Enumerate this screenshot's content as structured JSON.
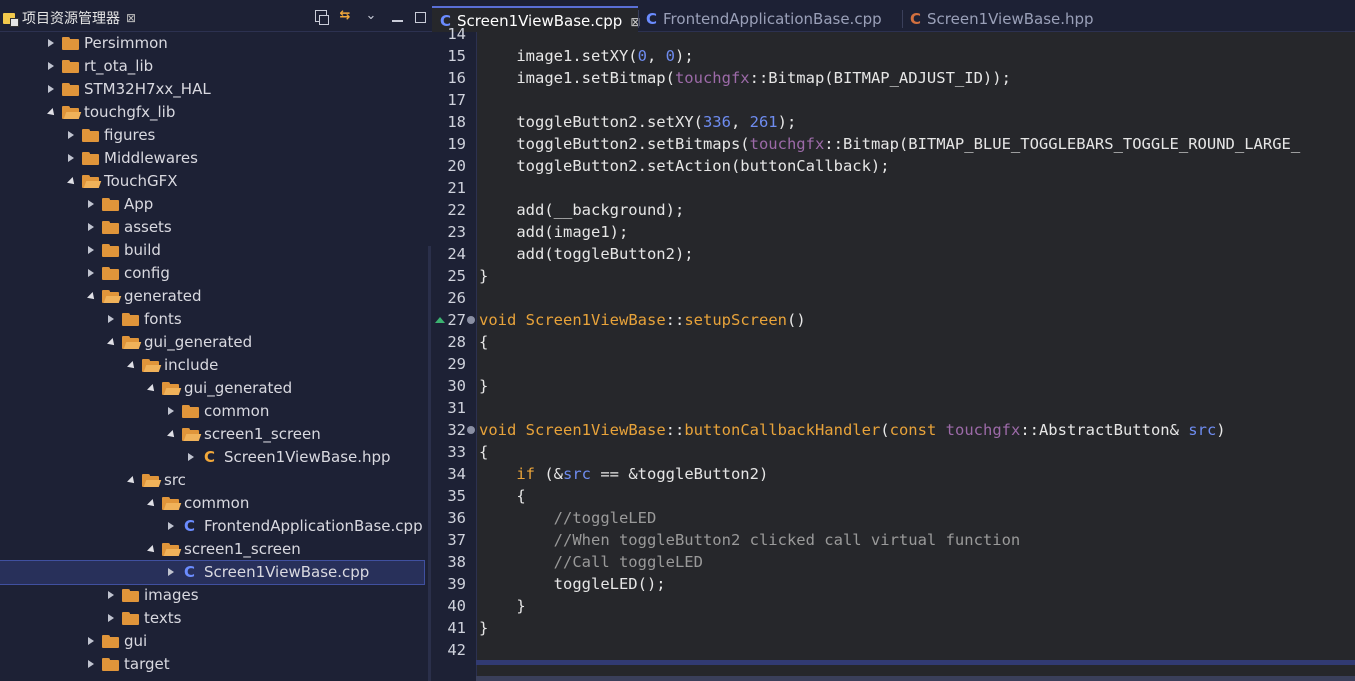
{
  "explorer": {
    "title": "项目资源管理器",
    "close_glyph": "⊠",
    "tree": [
      {
        "label": "Persimmon",
        "depth": 0,
        "kind": "folder",
        "expanded": false
      },
      {
        "label": "rt_ota_lib",
        "depth": 0,
        "kind": "folder",
        "expanded": false
      },
      {
        "label": "STM32H7xx_HAL",
        "depth": 0,
        "kind": "folder",
        "expanded": false
      },
      {
        "label": "touchgfx_lib",
        "depth": 0,
        "kind": "folder",
        "expanded": true
      },
      {
        "label": "figures",
        "depth": 1,
        "kind": "folder",
        "expanded": false
      },
      {
        "label": "Middlewares",
        "depth": 1,
        "kind": "folder",
        "expanded": false
      },
      {
        "label": "TouchGFX",
        "depth": 1,
        "kind": "folder",
        "expanded": true
      },
      {
        "label": "App",
        "depth": 2,
        "kind": "folder",
        "expanded": false
      },
      {
        "label": "assets",
        "depth": 2,
        "kind": "folder",
        "expanded": false
      },
      {
        "label": "build",
        "depth": 2,
        "kind": "folder",
        "expanded": false
      },
      {
        "label": "config",
        "depth": 2,
        "kind": "folder",
        "expanded": false
      },
      {
        "label": "generated",
        "depth": 2,
        "kind": "folder",
        "expanded": true
      },
      {
        "label": "fonts",
        "depth": 3,
        "kind": "folder",
        "expanded": false
      },
      {
        "label": "gui_generated",
        "depth": 3,
        "kind": "folder",
        "expanded": true
      },
      {
        "label": "include",
        "depth": 4,
        "kind": "folder",
        "expanded": true
      },
      {
        "label": "gui_generated",
        "depth": 5,
        "kind": "folder",
        "expanded": true
      },
      {
        "label": "common",
        "depth": 6,
        "kind": "folder",
        "expanded": false
      },
      {
        "label": "screen1_screen",
        "depth": 6,
        "kind": "folder",
        "expanded": true
      },
      {
        "label": "Screen1ViewBase.hpp",
        "depth": 7,
        "kind": "hpp",
        "expanded": false
      },
      {
        "label": "src",
        "depth": 4,
        "kind": "folder",
        "expanded": true
      },
      {
        "label": "common",
        "depth": 5,
        "kind": "folder",
        "expanded": true
      },
      {
        "label": "FrontendApplicationBase.cpp",
        "depth": 6,
        "kind": "cpp",
        "expanded": false
      },
      {
        "label": "screen1_screen",
        "depth": 5,
        "kind": "folder",
        "expanded": true
      },
      {
        "label": "Screen1ViewBase.cpp",
        "depth": 6,
        "kind": "cpp",
        "expanded": false,
        "selected": true
      },
      {
        "label": "images",
        "depth": 3,
        "kind": "folder",
        "expanded": false
      },
      {
        "label": "texts",
        "depth": 3,
        "kind": "folder",
        "expanded": false
      },
      {
        "label": "gui",
        "depth": 2,
        "kind": "folder",
        "expanded": false
      },
      {
        "label": "target",
        "depth": 2,
        "kind": "folder",
        "expanded": false
      }
    ]
  },
  "editor": {
    "tabs": [
      {
        "label": "Screen1ViewBase.cpp",
        "icon": "C",
        "kind": "cpp",
        "active": true,
        "close": "⊠"
      },
      {
        "label": "FrontendApplicationBase.cpp",
        "icon": "C",
        "kind": "cpp",
        "active": false
      },
      {
        "label": "Screen1ViewBase.hpp",
        "icon": "C",
        "kind": "hpp",
        "active": false
      }
    ],
    "lines": [
      {
        "n": "14",
        "segs": []
      },
      {
        "n": "15",
        "segs": [
          [
            "",
            "    image1.setXY("
          ],
          [
            "num",
            "0"
          ],
          [
            "",
            ", "
          ],
          [
            "num",
            "0"
          ],
          [
            "",
            ");"
          ]
        ]
      },
      {
        "n": "16",
        "segs": [
          [
            "",
            "    image1.setBitmap("
          ],
          [
            "ns",
            "touchgfx"
          ],
          [
            "",
            "::Bitmap(BITMAP_ADJUST_ID));"
          ]
        ]
      },
      {
        "n": "17",
        "segs": []
      },
      {
        "n": "18",
        "segs": [
          [
            "",
            "    toggleButton2.setXY("
          ],
          [
            "num",
            "336"
          ],
          [
            "",
            ", "
          ],
          [
            "num",
            "261"
          ],
          [
            "",
            ");"
          ]
        ]
      },
      {
        "n": "19",
        "segs": [
          [
            "",
            "    toggleButton2.setBitmaps("
          ],
          [
            "ns",
            "touchgfx"
          ],
          [
            "",
            "::Bitmap(BITMAP_BLUE_TOGGLEBARS_TOGGLE_ROUND_LARGE_"
          ]
        ]
      },
      {
        "n": "20",
        "segs": [
          [
            "",
            "    toggleButton2.setAction(buttonCallback);"
          ]
        ]
      },
      {
        "n": "21",
        "segs": []
      },
      {
        "n": "22",
        "segs": [
          [
            "",
            "    add(__background);"
          ]
        ]
      },
      {
        "n": "23",
        "segs": [
          [
            "",
            "    add(image1);"
          ]
        ]
      },
      {
        "n": "24",
        "segs": [
          [
            "",
            "    add(toggleButton2);"
          ]
        ]
      },
      {
        "n": "25",
        "segs": [
          [
            "",
            "}"
          ]
        ]
      },
      {
        "n": "26",
        "segs": []
      },
      {
        "n": "27",
        "marker": "arrow-fold",
        "segs": [
          [
            "kw",
            "void"
          ],
          [
            "",
            " "
          ],
          [
            "fn",
            "Screen1ViewBase"
          ],
          [
            "",
            "::"
          ],
          [
            "fn",
            "setupScreen"
          ],
          [
            "",
            "()"
          ]
        ]
      },
      {
        "n": "28",
        "segs": [
          [
            "",
            "{"
          ]
        ]
      },
      {
        "n": "29",
        "segs": []
      },
      {
        "n": "30",
        "segs": [
          [
            "",
            "}"
          ]
        ]
      },
      {
        "n": "31",
        "segs": []
      },
      {
        "n": "32",
        "marker": "fold",
        "segs": [
          [
            "kw",
            "void"
          ],
          [
            "",
            " "
          ],
          [
            "fn",
            "Screen1ViewBase"
          ],
          [
            "",
            "::"
          ],
          [
            "fn",
            "buttonCallbackHandler"
          ],
          [
            "",
            "("
          ],
          [
            "kw",
            "const"
          ],
          [
            "",
            " "
          ],
          [
            "ns",
            "touchgfx"
          ],
          [
            "",
            "::AbstractButton& "
          ],
          [
            "par",
            "src"
          ],
          [
            "",
            ")"
          ]
        ]
      },
      {
        "n": "33",
        "segs": [
          [
            "",
            "{"
          ]
        ]
      },
      {
        "n": "34",
        "segs": [
          [
            "",
            "    "
          ],
          [
            "kw",
            "if"
          ],
          [
            "",
            " (&"
          ],
          [
            "par",
            "src"
          ],
          [
            "",
            " == &toggleButton2)"
          ]
        ]
      },
      {
        "n": "35",
        "segs": [
          [
            "",
            "    {"
          ]
        ]
      },
      {
        "n": "36",
        "segs": [
          [
            "",
            "        "
          ],
          [
            "cm",
            "//toggleLED"
          ]
        ]
      },
      {
        "n": "37",
        "segs": [
          [
            "",
            "        "
          ],
          [
            "cm",
            "//When toggleButton2 clicked call virtual function"
          ]
        ]
      },
      {
        "n": "38",
        "segs": [
          [
            "",
            "        "
          ],
          [
            "cm",
            "//Call toggleLED"
          ]
        ]
      },
      {
        "n": "39",
        "segs": [
          [
            "",
            "        toggleLED();"
          ]
        ]
      },
      {
        "n": "40",
        "segs": [
          [
            "",
            "    }"
          ]
        ]
      },
      {
        "n": "41",
        "segs": [
          [
            "",
            "}"
          ]
        ]
      },
      {
        "n": "42",
        "segs": []
      }
    ]
  },
  "colors": {
    "keyword": "#e8a33a",
    "number": "#6e8cf0",
    "namespace": "#9c6aa8",
    "comment": "#9a9a9a",
    "cpp_icon": "#6b8cff",
    "hpp_icon": "#f2a83a",
    "folder": "#e0953a"
  }
}
